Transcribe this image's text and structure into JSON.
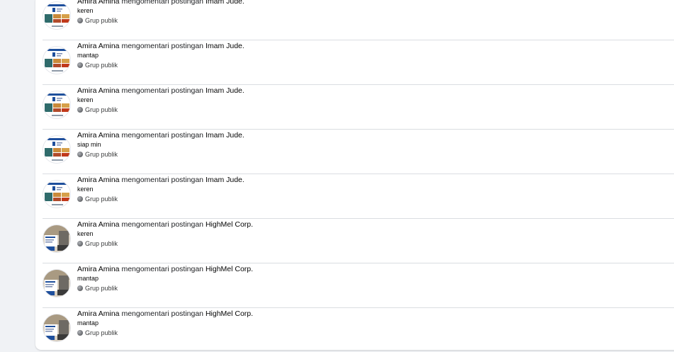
{
  "activity": [
    {
      "actor": "Amira Amina",
      "verb": "mengomentari postingan",
      "target": "Imam Jude.",
      "comment": "keren",
      "audience": "Grup publik",
      "thumb_style": "imam"
    },
    {
      "actor": "Amira Amina",
      "verb": "mengomentari postingan",
      "target": "Imam Jude.",
      "comment": "mantap",
      "audience": "Grup publik",
      "thumb_style": "imam"
    },
    {
      "actor": "Amira Amina",
      "verb": "mengomentari postingan",
      "target": "Imam Jude.",
      "comment": "keren",
      "audience": "Grup publik",
      "thumb_style": "imam"
    },
    {
      "actor": "Amira Amina",
      "verb": "mengomentari postingan",
      "target": "Imam Jude.",
      "comment": "siap min",
      "audience": "Grup publik",
      "thumb_style": "imam"
    },
    {
      "actor": "Amira Amina",
      "verb": "mengomentari postingan",
      "target": "Imam Jude.",
      "comment": "keren",
      "audience": "Grup publik",
      "thumb_style": "imam"
    },
    {
      "actor": "Amira Amina",
      "verb": "mengomentari postingan",
      "target": "HighMel Corp.",
      "comment": "keren",
      "audience": "Grup publik",
      "thumb_style": "highmel"
    },
    {
      "actor": "Amira Amina",
      "verb": "mengomentari postingan",
      "target": "HighMel Corp.",
      "comment": "mantap",
      "audience": "Grup publik",
      "thumb_style": "highmel"
    },
    {
      "actor": "Amira Amina",
      "verb": "mengomentari postingan",
      "target": "HighMel Corp.",
      "comment": "mantap",
      "audience": "Grup publik",
      "thumb_style": "highmel"
    }
  ],
  "icons": {
    "audience_icon": "globe-icon"
  },
  "colors": {
    "background": "#f0f2f5",
    "card": "#ffffff",
    "divider": "#dadde1",
    "text": "#050505",
    "muted": "#65676b"
  }
}
